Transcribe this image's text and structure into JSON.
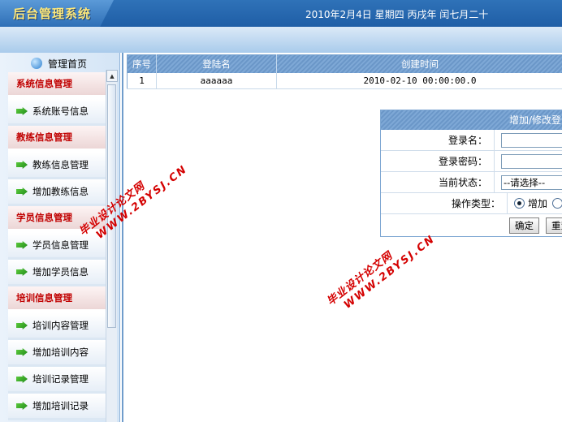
{
  "header": {
    "app_title": "后台管理系统",
    "date_text": "2010年2月4日 星期四 丙戌年 闰七月二十"
  },
  "sidebar": {
    "home_label": "管理首页",
    "menu": [
      {
        "type": "category",
        "label": "系统信息管理"
      },
      {
        "type": "item",
        "label": "系统账号信息"
      },
      {
        "type": "category",
        "label": "教练信息管理"
      },
      {
        "type": "item",
        "label": "教练信息管理"
      },
      {
        "type": "item",
        "label": "增加教练信息"
      },
      {
        "type": "category",
        "label": "学员信息管理"
      },
      {
        "type": "item",
        "label": "学员信息管理"
      },
      {
        "type": "item",
        "label": "增加学员信息"
      },
      {
        "type": "category",
        "label": "培训信息管理"
      },
      {
        "type": "item",
        "label": "培训内容管理"
      },
      {
        "type": "item",
        "label": "增加培训内容"
      },
      {
        "type": "item",
        "label": "培训记录管理"
      },
      {
        "type": "item",
        "label": "增加培训记录"
      }
    ]
  },
  "table": {
    "headers": [
      "序号",
      "登陆名",
      "创建时间"
    ],
    "rows": [
      [
        "1",
        "aaaaaa",
        "2010-02-10 00:00:00.0"
      ]
    ]
  },
  "form": {
    "title": "增加/修改登录",
    "login_label": "登录名：",
    "password_label": "登录密码：",
    "status_label": "当前状态：",
    "status_selected": "--请选择--",
    "action_label": "操作类型：",
    "action_add": "增加",
    "confirm_label": "确定",
    "reset_label": "重置"
  },
  "watermark": {
    "cn": "毕业设计论文网",
    "en": "WWW.2BYSJ.CN"
  },
  "colors": {
    "header_blue": "#2f72b8",
    "category_red": "#c00000",
    "watermark_red": "#d40000"
  }
}
